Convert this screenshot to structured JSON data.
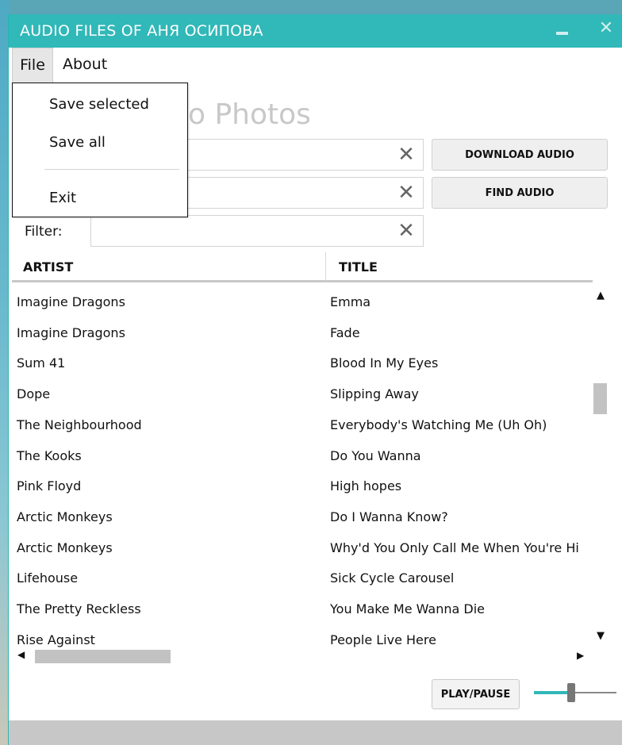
{
  "window": {
    "title": "AUDIO FILES OF АНЯ ОСИПОВА",
    "close_glyph": "✕",
    "accent_color": "#31b8b8"
  },
  "menu": {
    "file_label": "File",
    "about_label": "About",
    "file_items": [
      "Save selected",
      "Save all",
      "Exit"
    ]
  },
  "heading_partial": "o  Photos",
  "fields": {
    "clear_glyph": "✕",
    "filter_label": "Filter:"
  },
  "buttons": {
    "download_audio": "DOWNLOAD AUDIO",
    "find_audio": "FIND AUDIO",
    "play_pause": "PLAY/PAUSE"
  },
  "grid": {
    "columns": [
      "ARTIST",
      "TITLE"
    ],
    "rows": [
      {
        "artist": "Imagine Dragons",
        "title": "Emma"
      },
      {
        "artist": "Imagine Dragons",
        "title": "Fade"
      },
      {
        "artist": "Sum 41",
        "title": "Blood In My Eyes"
      },
      {
        "artist": "Dope",
        "title": "Slipping Away"
      },
      {
        "artist": "The Neighbourhood",
        "title": "Everybody's Watching Me (Uh Oh)"
      },
      {
        "artist": "The Kooks",
        "title": "Do You Wanna"
      },
      {
        "artist": "Pink Floyd",
        "title": "High hopes"
      },
      {
        "artist": "Arctic Monkeys",
        "title": "Do I Wanna Know?"
      },
      {
        "artist": "Arctic Monkeys",
        "title": "Why'd You Only Call Me When You're Hi"
      },
      {
        "artist": "Lifehouse",
        "title": "Sick Cycle Carousel"
      },
      {
        "artist": "The Pretty Reckless",
        "title": "You Make Me Wanna Die"
      },
      {
        "artist": "Rise Against",
        "title": "People Live Here"
      }
    ]
  },
  "scroll_glyphs": {
    "up": "▲",
    "down": "▼",
    "left": "◀",
    "right": "▶"
  },
  "volume": {
    "level": 0.45
  }
}
